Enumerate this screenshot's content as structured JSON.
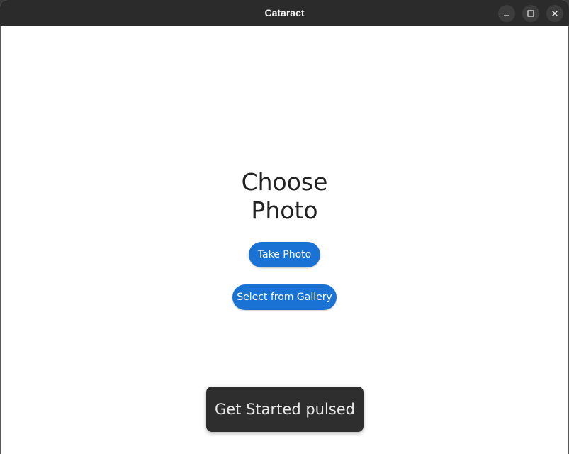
{
  "window": {
    "title": "Cataract",
    "controls": {
      "minimize_icon": "minimize-icon",
      "maximize_icon": "maximize-icon",
      "close_icon": "close-icon"
    }
  },
  "main": {
    "heading_line1": "Choose",
    "heading_line2": "Photo",
    "take_photo_label": "Take Photo",
    "gallery_label": "Select from Gallery"
  },
  "toast": {
    "message": "Get Started pulsed"
  },
  "colors": {
    "accent": "#1a73d4",
    "titlebar": "#2b2b2b",
    "toast_bg": "#2e2e2e"
  }
}
